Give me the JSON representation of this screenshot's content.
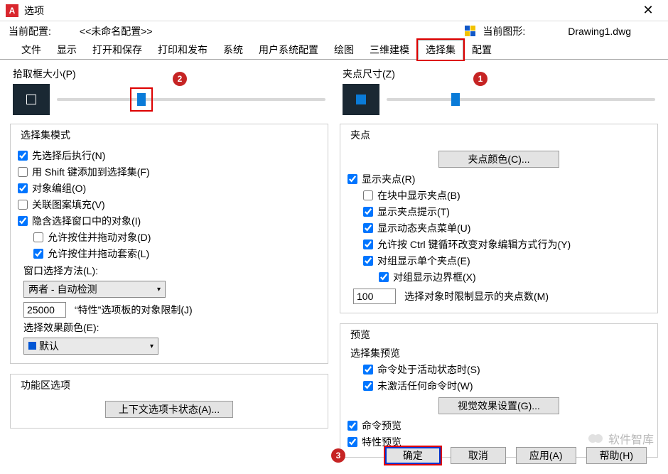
{
  "window": {
    "title": "选项"
  },
  "info": {
    "profile_lbl": "当前配置:",
    "profile": "<<未命名配置>>",
    "drawing_lbl": "当前图形:",
    "drawing": "Drawing1.dwg"
  },
  "tabs": [
    "文件",
    "显示",
    "打开和保存",
    "打印和发布",
    "系统",
    "用户系统配置",
    "绘图",
    "三维建模",
    "选择集",
    "配置"
  ],
  "active_tab": "选择集",
  "left": {
    "pick_title": "拾取框大小(P)",
    "mode_title": "选择集模式",
    "m1": "先选择后执行(N)",
    "m2": "用 Shift 键添加到选择集(F)",
    "m3": "对象编组(O)",
    "m4": "关联图案填充(V)",
    "m5": "隐含选择窗口中的对象(I)",
    "m5a": "允许按住并拖动对象(D)",
    "m5b": "允许按住并拖动套索(L)",
    "wsel_lbl": "窗口选择方法(L):",
    "wsel_val": "两者 - 自动检测",
    "limit_val": "25000",
    "limit_lbl": "“特性”选项板的对象限制(J)",
    "effcolor_lbl": "选择效果颜色(E):",
    "effcolor_val": "默认",
    "ribbon_title": "功能区选项",
    "ctx_btn": "上下文选项卡状态(A)..."
  },
  "right": {
    "grip_title": "夹点尺寸(Z)",
    "grips_title": "夹点",
    "gcolor_btn": "夹点颜色(C)...",
    "g1": "显示夹点(R)",
    "g1a": "在块中显示夹点(B)",
    "g1b": "显示夹点提示(T)",
    "g1c": "显示动态夹点菜单(U)",
    "g1d": "允许按 Ctrl 键循环改变对象编辑方式行为(Y)",
    "g1e": "对组显示单个夹点(E)",
    "g1e1": "对组显示边界框(X)",
    "glimit_val": "100",
    "glimit_lbl": "选择对象时限制显示的夹点数(M)",
    "preview_title": "预览",
    "pv_sub": "选择集预览",
    "pv1": "命令处于活动状态时(S)",
    "pv2": "未激活任何命令时(W)",
    "pv_btn": "视觉效果设置(G)...",
    "pv3": "命令预览",
    "pv4": "特性预览"
  },
  "footer": {
    "ok": "确定",
    "cancel": "取消",
    "apply": "应用(A)",
    "help": "帮助(H)"
  },
  "badges": {
    "b1": "1",
    "b2": "2",
    "b3": "3"
  },
  "watermark": "软件智库"
}
